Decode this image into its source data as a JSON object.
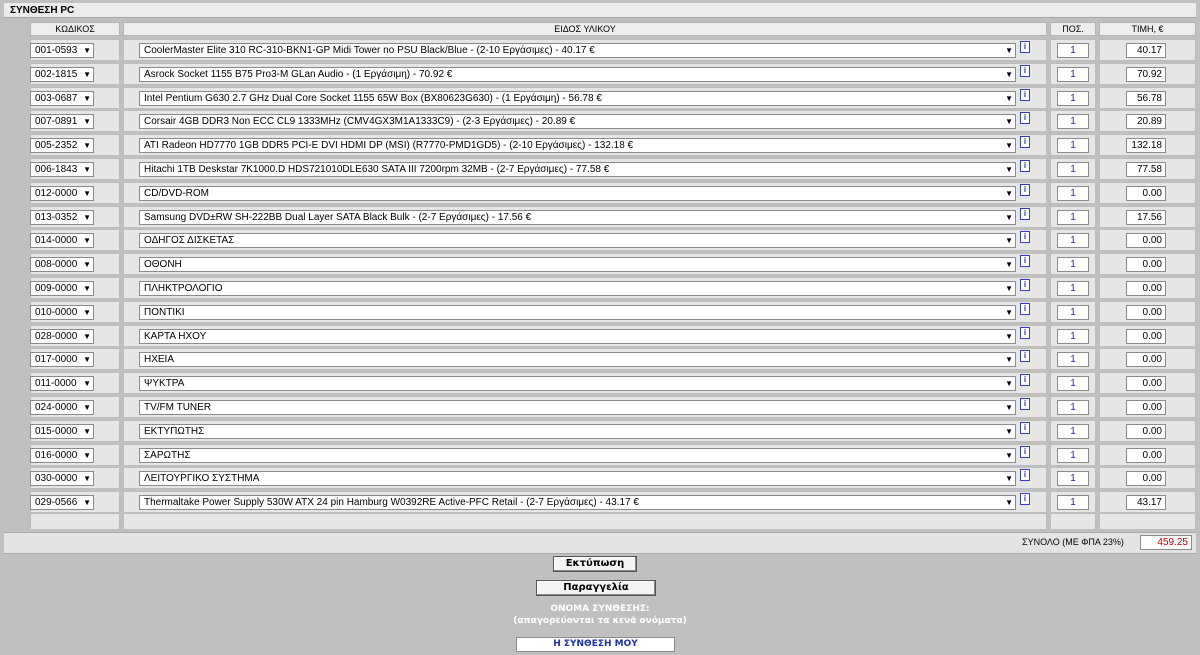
{
  "title": "ΣΥΝΘΕΣΗ PC",
  "headers": {
    "code": "ΚΩΔΙΚΟΣ",
    "item": "ΕΙΔΟΣ ΥΛΙΚΟΥ",
    "qty": "ΠΟΣ.",
    "price": "ΤΙΜΗ, €"
  },
  "info_icon": "i",
  "rows": [
    {
      "code": "001-0593",
      "item": "CoolerMaster Elite 310 RC-310-BKN1-GP Midi Tower no PSU Black/Blue - (2-10 Εργάσιμες) - 40.17 €",
      "qty": "1",
      "price": "40.17"
    },
    {
      "code": "002-1815",
      "item": "Asrock Socket 1155 B75 Pro3-M GLan Audio - (1 Εργάσιμη) - 70.92 €",
      "qty": "1",
      "price": "70.92"
    },
    {
      "code": "003-0687",
      "item": "Intel Pentium G630 2.7 GHz Dual Core Socket 1155 65W Box (BX80623G630) - (1 Εργάσιμη) - 56.78 €",
      "qty": "1",
      "price": "56.78"
    },
    {
      "code": "007-0891",
      "item": "Corsair 4GB DDR3 Non ECC CL9 1333MHz (CMV4GX3M1A1333C9) - (2-3 Εργάσιμες) - 20.89 €",
      "qty": "1",
      "price": "20.89"
    },
    {
      "code": "005-2352",
      "item": "ATI Radeon HD7770 1GB DDR5 PCI-E DVI HDMI DP (MSI) (R7770-PMD1GD5) - (2-10 Εργάσιμες) - 132.18 €",
      "qty": "1",
      "price": "132.18"
    },
    {
      "code": "006-1843",
      "item": "Hitachi 1TB Deskstar 7K1000.D HDS721010DLE630 SATA III 7200rpm 32MB - (2-7 Εργάσιμες) - 77.58 €",
      "qty": "1",
      "price": "77.58"
    },
    {
      "code": "012-0000",
      "item": "CD/DVD-ROM",
      "qty": "1",
      "price": "0.00"
    },
    {
      "code": "013-0352",
      "item": "Samsung DVD±RW SH-222BB Dual Layer SATA Black Bulk - (2-7 Εργάσιμες) - 17.56 €",
      "qty": "1",
      "price": "17.56"
    },
    {
      "code": "014-0000",
      "item": "ΟΔΗΓΟΣ ΔΙΣΚΕΤΑΣ",
      "qty": "1",
      "price": "0.00"
    },
    {
      "code": "008-0000",
      "item": "ΟΘΟΝΗ",
      "qty": "1",
      "price": "0.00"
    },
    {
      "code": "009-0000",
      "item": "ΠΛΗΚΤΡΟΛΟΓΙΟ",
      "qty": "1",
      "price": "0.00"
    },
    {
      "code": "010-0000",
      "item": "ΠΟΝΤΙΚΙ",
      "qty": "1",
      "price": "0.00"
    },
    {
      "code": "028-0000",
      "item": "ΚΑΡΤΑ ΗΧΟΥ",
      "qty": "1",
      "price": "0.00"
    },
    {
      "code": "017-0000",
      "item": "ΗΧΕΙΑ",
      "qty": "1",
      "price": "0.00"
    },
    {
      "code": "011-0000",
      "item": "ΨΥΚΤΡΑ",
      "qty": "1",
      "price": "0.00"
    },
    {
      "code": "024-0000",
      "item": "TV/FM TUNER",
      "qty": "1",
      "price": "0.00"
    },
    {
      "code": "015-0000",
      "item": "ΕΚΤΥΠΩΤΗΣ",
      "qty": "1",
      "price": "0.00"
    },
    {
      "code": "016-0000",
      "item": "ΣΑΡΩΤΗΣ",
      "qty": "1",
      "price": "0.00"
    },
    {
      "code": "030-0000",
      "item": "ΛΕΙΤΟΥΡΓΙΚΟ ΣΥΣΤΗΜΑ",
      "qty": "1",
      "price": "0.00"
    },
    {
      "code": "029-0566",
      "item": "Thermaltake Power Supply 530W ATX 24 pin Hamburg W0392RE Active-PFC Retail - (2-7 Εργάσιμες) - 43.17 €",
      "qty": "1",
      "price": "43.17"
    }
  ],
  "total": {
    "label": "ΣΥΝΟΛΟ (ΜΕ ΦΠΑ 23%)",
    "value": "459.25",
    "value_color": "#c00000"
  },
  "buttons": {
    "print": "Εκτύπωση",
    "order": "Παραγγελία"
  },
  "composition": {
    "label": "ΟΝΟΜΑ ΣΥΝΘΕΣΗΣ:",
    "hint": "(απαγορεύονται τα κενά ονόματα)",
    "value": "Η ΣΥΝΘΕΣΗ ΜΟΥ"
  }
}
